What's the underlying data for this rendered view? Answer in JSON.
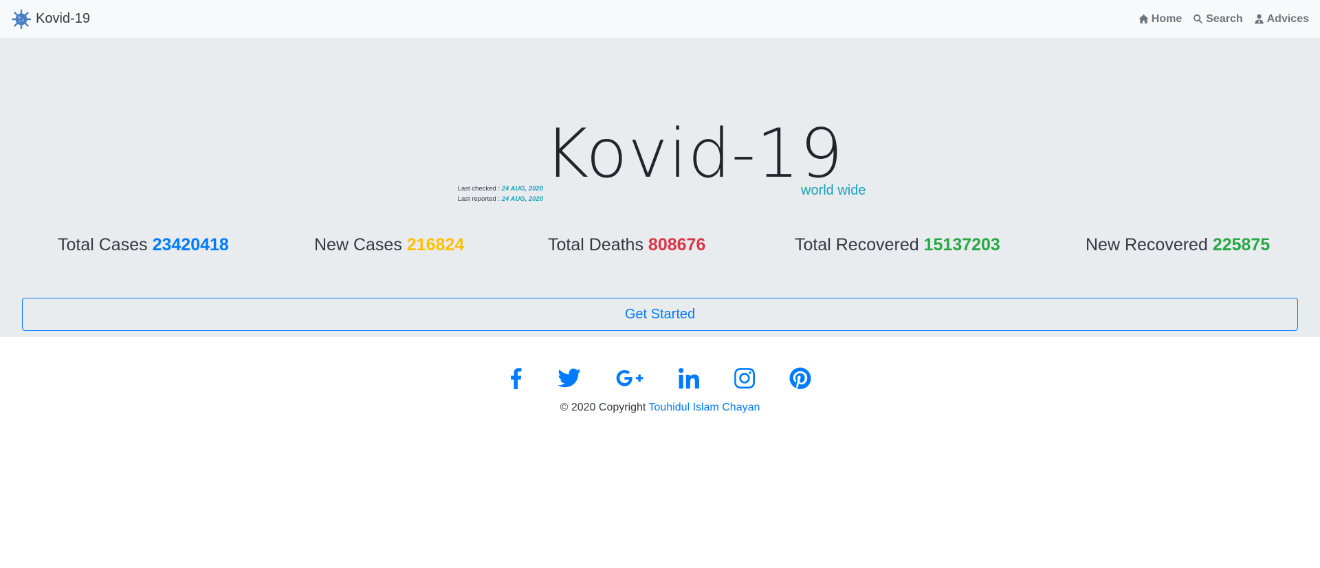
{
  "navbar": {
    "brand": "Kovid-19",
    "logo_icon": "virus-icon",
    "links": [
      {
        "label": "Home",
        "icon": "home-icon"
      },
      {
        "label": "Search",
        "icon": "search-icon"
      },
      {
        "label": "Advices",
        "icon": "user-doctor-icon"
      }
    ]
  },
  "hero": {
    "title": "Kovid-19",
    "subtitle": "world wide",
    "last_checked_label": "Last checked : ",
    "last_checked_value": "24 AUG, 2020",
    "last_reported_label": "Last reported : ",
    "last_reported_value": "24 AUG, 2020"
  },
  "stats": [
    {
      "label": "Total Cases",
      "value": "23420418",
      "color": "#007bff"
    },
    {
      "label": "New Cases",
      "value": "216824",
      "color": "#ffc107"
    },
    {
      "label": "Total Deaths",
      "value": "808676",
      "color": "#dc3545"
    },
    {
      "label": "Total Recovered",
      "value": "15137203",
      "color": "#28a745"
    },
    {
      "label": "New Recovered",
      "value": "225875",
      "color": "#28a745"
    }
  ],
  "cta": {
    "label": "Get Started"
  },
  "footer": {
    "social": [
      "facebook-icon",
      "twitter-icon",
      "google-plus-icon",
      "linkedin-icon",
      "instagram-icon",
      "pinterest-icon"
    ],
    "copyright_prefix": "© 2020 Copyright ",
    "author": "Touhidul Islam Chayan"
  },
  "colors": {
    "accent": "#007bff",
    "info": "#17a2b8",
    "navbar_bg": "#f8f9fa",
    "jumbotron_bg": "#e9ecef"
  }
}
